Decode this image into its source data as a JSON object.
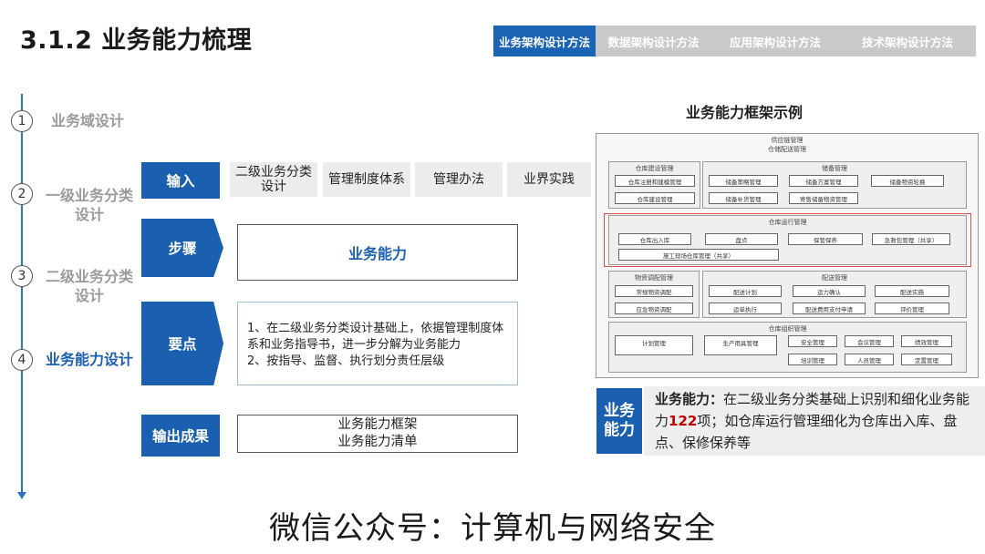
{
  "page_title": "3.1.2 业务能力梳理",
  "tabs": [
    {
      "label": "业务架构设计方法",
      "active": true
    },
    {
      "label": "数据架构设计方法",
      "active": false
    },
    {
      "label": "应用架构设计方法",
      "active": false
    },
    {
      "label": "技术架构设计方法",
      "active": false
    }
  ],
  "timeline": [
    {
      "num": "1",
      "label": "业务域设计"
    },
    {
      "num": "2",
      "label": "一级业务分类设计"
    },
    {
      "num": "3",
      "label": "二级业务分类设计"
    },
    {
      "num": "4",
      "label": "业务能力设计"
    }
  ],
  "rows": {
    "input": {
      "label": "输入",
      "items": [
        "二级业务分类设计",
        "管理制度体系",
        "管理办法",
        "业界实践"
      ]
    },
    "steps": {
      "label": "步骤",
      "content": "业务能力"
    },
    "key_points": {
      "label": "要点",
      "lines": [
        "1、在二级业务分类设计基础上，依据管理制度体系和业务指导书，进一步分解为业务能力",
        "2、按指导、监督、执行划分责任层级"
      ]
    },
    "output": {
      "label": "输出成果",
      "lines": [
        "业务能力框架",
        "业务能力清单"
      ]
    }
  },
  "framework": {
    "title": "业务能力框架示例",
    "top1": "供应链管理",
    "top2": "仓储配送管理",
    "sections": [
      {
        "title": "仓库建设管理",
        "cells": [
          "仓库注册和建模管理",
          "仓库建设管理"
        ]
      },
      {
        "title": "储备管理",
        "cells": [
          "储备策略管理",
          "储备方案管理",
          "储备物资轮换",
          "储备补货管理",
          "寄售储备物资管理"
        ]
      },
      {
        "title": "仓库运行管理",
        "cells": [
          "仓库出入库",
          "盘点",
          "保管保养",
          "急救包管理（共享）",
          "施工现场仓库管理（共享）"
        ]
      },
      {
        "title": "物资调配管理",
        "cells": [
          "常规物资调配",
          "应急物资调配"
        ]
      },
      {
        "title": "配送管理",
        "cells": [
          "配送计划",
          "运力确认",
          "配送实施",
          "运单执行",
          "配送费用支付申请",
          "评价管理"
        ]
      },
      {
        "title": "仓库组织管理",
        "cells": [
          "计划管理",
          "生产用具管理",
          "安全管理",
          "会议管理",
          "绩效管理",
          "培训管理",
          "人员管理",
          "定置管理"
        ]
      }
    ]
  },
  "capability": {
    "badge": "业务能力",
    "term": "业务能力",
    "colon": "：",
    "text_before": "在二级业务分类基础上识别和细化业务能力",
    "count": "122",
    "text_after": "项；如仓库运行管理细化为仓库出入库、盘点、保修保养等"
  },
  "footer": "微信公众号：计算机与网络安全"
}
